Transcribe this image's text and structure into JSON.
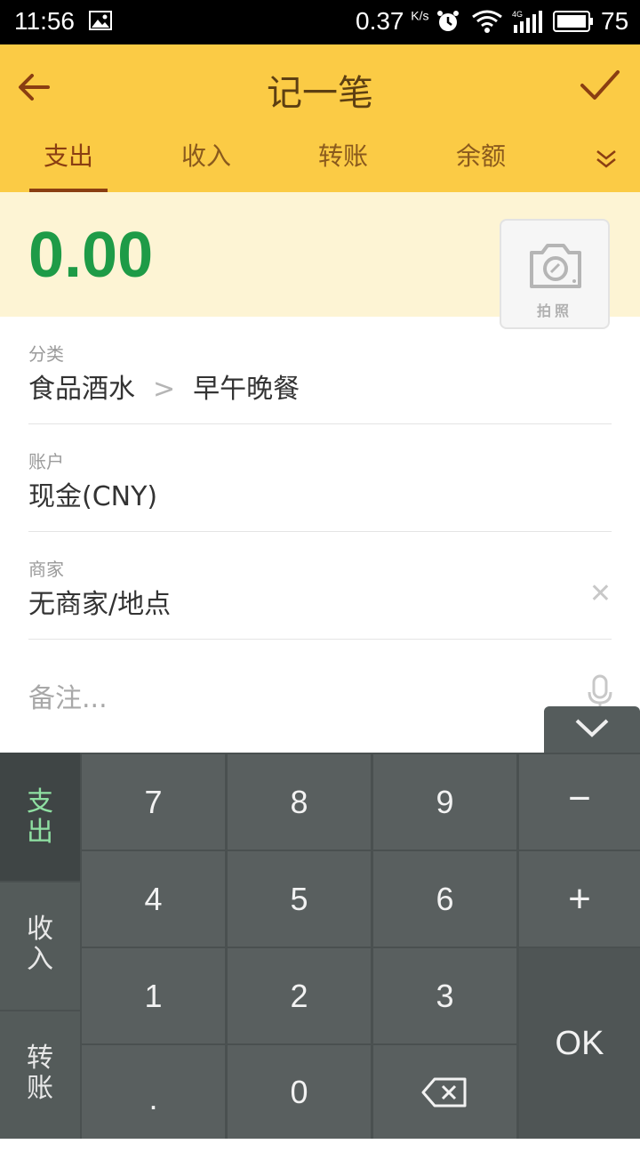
{
  "status": {
    "time": "11:56",
    "speed": "0.37",
    "speed_unit": "K/s",
    "network": "4G",
    "battery": "75"
  },
  "header": {
    "title": "记一笔"
  },
  "tabs": [
    "支出",
    "收入",
    "转账",
    "余额"
  ],
  "amount": "0.00",
  "photo_label": "拍照",
  "fields": {
    "category": {
      "label": "分类",
      "main": "食品酒水",
      "sub": "早午晚餐"
    },
    "account": {
      "label": "账户",
      "value": "现金(CNY)"
    },
    "merchant": {
      "label": "商家",
      "value": "无商家/地点"
    },
    "note_placeholder": "备注..."
  },
  "keypad": {
    "side": [
      [
        "支",
        "出"
      ],
      [
        "收",
        "入"
      ],
      [
        "转",
        "账"
      ]
    ],
    "digits": [
      "7",
      "8",
      "9",
      "4",
      "5",
      "6",
      "1",
      "2",
      "3",
      ".",
      "0"
    ],
    "minus": "−",
    "plus": "+",
    "ok": "OK"
  },
  "colors": {
    "header": "#fbcb45",
    "amount": "#1e9b47",
    "keypad_bg": "#4a5050"
  }
}
